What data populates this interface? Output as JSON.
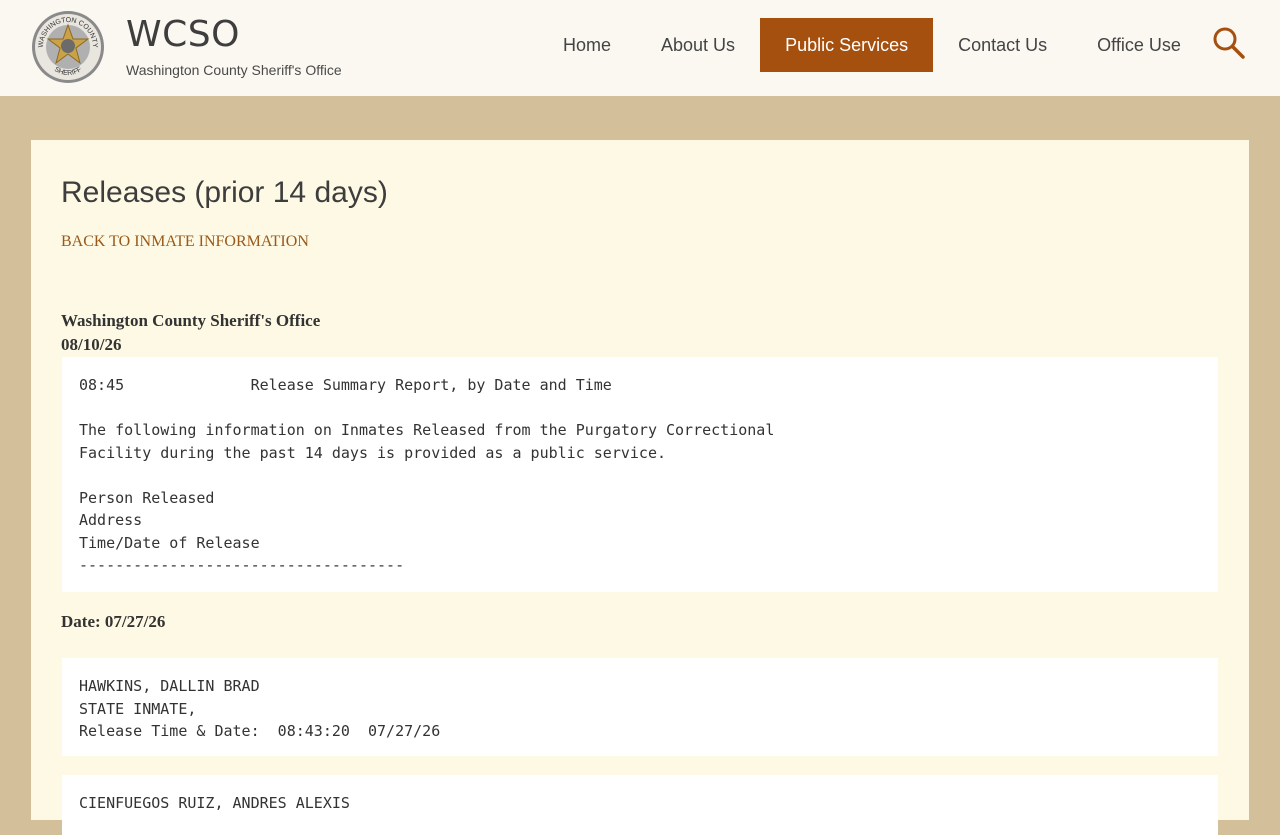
{
  "header": {
    "site_title": "WCSO",
    "site_subtitle": "Washington County Sheriff's Office",
    "logo_text_top": "WASHINGTON COUNTY",
    "logo_text_bottom": "SHERIFF"
  },
  "nav": {
    "items": [
      {
        "label": "Home",
        "active": false
      },
      {
        "label": "About Us",
        "active": false
      },
      {
        "label": "Public Services",
        "active": true
      },
      {
        "label": "Contact Us",
        "active": false
      },
      {
        "label": "Office Use",
        "active": false
      }
    ]
  },
  "colors": {
    "accent": "#a5500f",
    "page_bg": "#d3bf9a",
    "content_bg": "#fef9e4",
    "link": "#98591a"
  },
  "page": {
    "title": "Releases (prior 14 days)",
    "back_link": "BACK TO INMATE INFORMATION",
    "org_name": "Washington County Sheriff's Office",
    "report_date": "08/10/26"
  },
  "report": {
    "header_lines": [
      "08:45              Release Summary Report, by Date and Time",
      "",
      "The following information on Inmates Released from the Purgatory Correctional",
      "Facility during the past 14 days is provided as a public service.",
      "",
      "Person Released",
      "Address",
      "Time/Date of Release",
      "------------------------------------"
    ]
  },
  "release_groups": [
    {
      "date_label": "Date: 07/27/26",
      "records": [
        {
          "lines": [
            "HAWKINS, DALLIN BRAD",
            "STATE INMATE,",
            "Release Time & Date:  08:43:20  07/27/26"
          ]
        },
        {
          "lines": [
            "CIENFUEGOS RUIZ, ANDRES ALEXIS"
          ]
        }
      ]
    }
  ]
}
